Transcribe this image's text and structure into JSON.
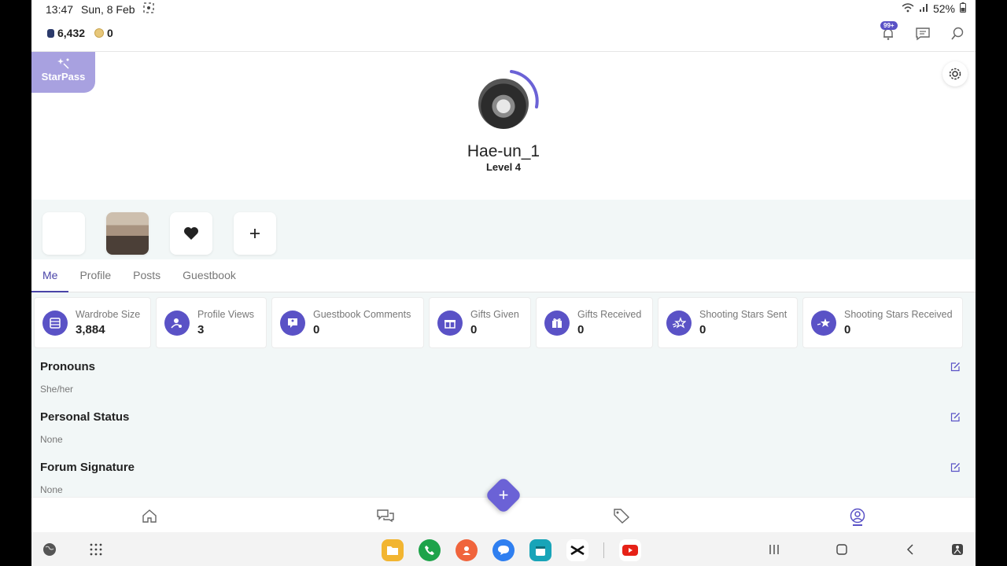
{
  "status_bar": {
    "time": "13:47",
    "date": "Sun, 8 Feb",
    "battery": "52%"
  },
  "header": {
    "gems": "6,432",
    "coins": "0",
    "notification_badge": "99+"
  },
  "starpass": {
    "label": "StarPass"
  },
  "profile": {
    "username": "Hae-un_1",
    "level": "Level 4"
  },
  "tabs": [
    {
      "label": "Me"
    },
    {
      "label": "Profile"
    },
    {
      "label": "Posts"
    },
    {
      "label": "Guestbook"
    }
  ],
  "stats": [
    {
      "label": "Wardrobe Size",
      "value": "3,884",
      "icon": "wardrobe-icon"
    },
    {
      "label": "Profile Views",
      "value": "3",
      "icon": "profile-views-icon"
    },
    {
      "label": "Guestbook Comments",
      "value": "0",
      "icon": "guestbook-icon"
    },
    {
      "label": "Gifts Given",
      "value": "0",
      "icon": "gift-icon"
    },
    {
      "label": "Gifts Received",
      "value": "0",
      "icon": "gifts-received-icon"
    },
    {
      "label": "Shooting Stars Sent",
      "value": "0",
      "icon": "shooting-star-icon"
    },
    {
      "label": "Shooting Stars Received",
      "value": "0",
      "icon": "star-badge-icon"
    }
  ],
  "fields": [
    {
      "title": "Pronouns",
      "value": "She/her"
    },
    {
      "title": "Personal Status",
      "value": "None"
    },
    {
      "title": "Forum Signature",
      "value": "None"
    }
  ],
  "colors": {
    "accent": "#5a52c6",
    "starpass": "#a8a1e0",
    "content_bg": "#f2f7f7"
  }
}
